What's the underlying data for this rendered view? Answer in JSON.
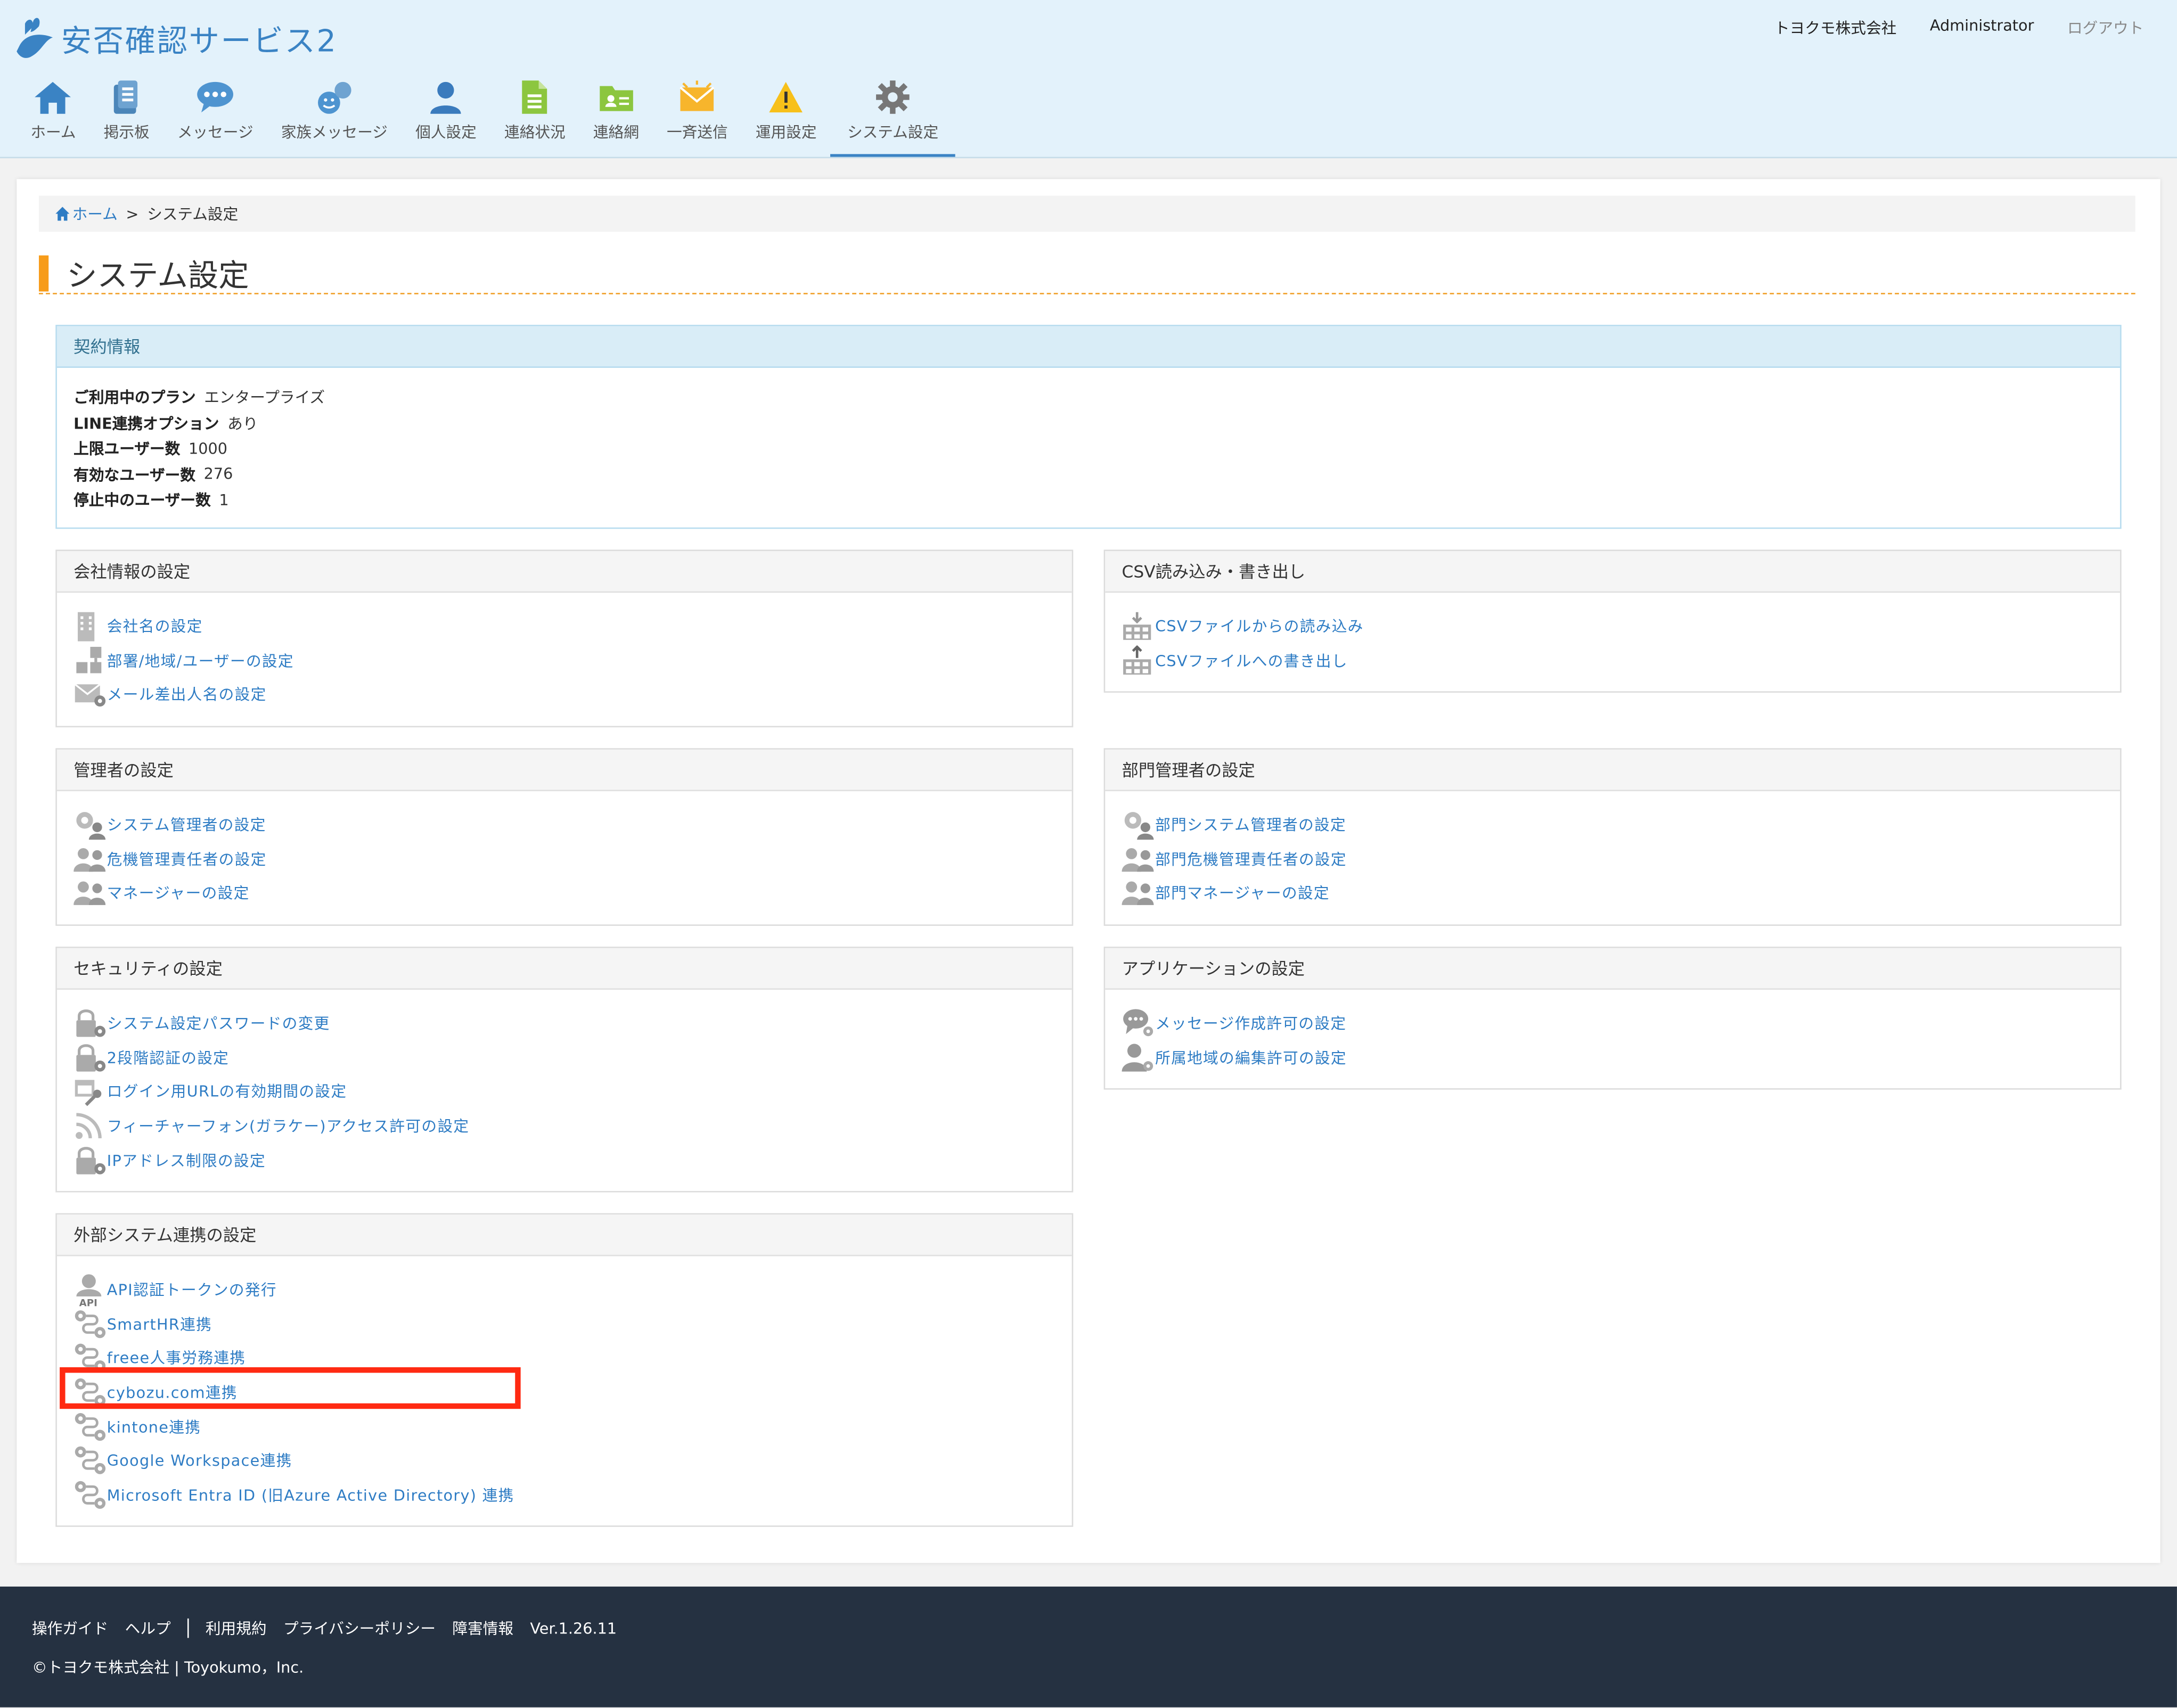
{
  "app": {
    "name": "安否確認サービス2",
    "company": "トヨクモ株式会社",
    "user": "Administrator",
    "logout": "ログアウト"
  },
  "nav": [
    {
      "label": "ホーム",
      "icon": "home-icon"
    },
    {
      "label": "掲示板",
      "icon": "board-icon"
    },
    {
      "label": "メッセージ",
      "icon": "message-icon"
    },
    {
      "label": "家族メッセージ",
      "icon": "family-message-icon"
    },
    {
      "label": "個人設定",
      "icon": "person-icon"
    },
    {
      "label": "連絡状況",
      "icon": "document-icon"
    },
    {
      "label": "連絡網",
      "icon": "contact-network-icon"
    },
    {
      "label": "一斉送信",
      "icon": "broadcast-mail-icon"
    },
    {
      "label": "運用設定",
      "icon": "warning-icon"
    },
    {
      "label": "システム設定",
      "icon": "gear-icon"
    }
  ],
  "breadcrumb": {
    "home": "ホーム",
    "sep": ">",
    "current": "システム設定"
  },
  "page_title": "システム設定",
  "contract": {
    "title": "契約情報",
    "rows": [
      {
        "label": "ご利用中のプラン",
        "value": "エンタープライズ"
      },
      {
        "label": "LINE連携オプション",
        "value": "あり"
      },
      {
        "label": "上限ユーザー数",
        "value": "1000"
      },
      {
        "label": "有効なユーザー数",
        "value": "276"
      },
      {
        "label": "停止中のユーザー数",
        "value": "1"
      }
    ]
  },
  "sections": {
    "company": {
      "title": "会社情報の設定",
      "items": [
        {
          "label": "会社名の設定",
          "icon": "building-icon"
        },
        {
          "label": "部署/地域/ユーザーの設定",
          "icon": "org-icon"
        },
        {
          "label": "メール差出人名の設定",
          "icon": "mail-gear-icon"
        }
      ]
    },
    "csv": {
      "title": "CSV読み込み・書き出し",
      "items": [
        {
          "label": "CSVファイルからの読み込み",
          "icon": "csv-import-icon"
        },
        {
          "label": "CSVファイルへの書き出し",
          "icon": "csv-export-icon"
        }
      ]
    },
    "admin": {
      "title": "管理者の設定",
      "items": [
        {
          "label": "システム管理者の設定",
          "icon": "gear-user-icon"
        },
        {
          "label": "危機管理責任者の設定",
          "icon": "users-icon"
        },
        {
          "label": "マネージャーの設定",
          "icon": "users-icon"
        }
      ]
    },
    "dept_admin": {
      "title": "部門管理者の設定",
      "items": [
        {
          "label": "部門システム管理者の設定",
          "icon": "gear-user-icon"
        },
        {
          "label": "部門危機管理責任者の設定",
          "icon": "users-icon"
        },
        {
          "label": "部門マネージャーの設定",
          "icon": "users-icon"
        }
      ]
    },
    "security": {
      "title": "セキュリティの設定",
      "items": [
        {
          "label": "システム設定パスワードの変更",
          "icon": "lock-gear-icon"
        },
        {
          "label": "2段階認証の設定",
          "icon": "lock-gear-icon"
        },
        {
          "label": "ログイン用URLの有効期間の設定",
          "icon": "calendar-key-icon"
        },
        {
          "label": "フィーチャーフォン(ガラケー)アクセス許可の設定",
          "icon": "wireless-icon"
        },
        {
          "label": "IPアドレス制限の設定",
          "icon": "lock-gear-icon"
        }
      ]
    },
    "application": {
      "title": "アプリケーションの設定",
      "items": [
        {
          "label": "メッセージ作成許可の設定",
          "icon": "speech-gear-icon"
        },
        {
          "label": "所属地域の編集許可の設定",
          "icon": "user-gear-icon"
        }
      ]
    },
    "external": {
      "title": "外部システム連携の設定",
      "items": [
        {
          "label": "API認証トークンの発行",
          "icon": "api-user-icon"
        },
        {
          "label": "SmartHR連携",
          "icon": "link-icon"
        },
        {
          "label": "freee人事労務連携",
          "icon": "link-icon"
        },
        {
          "label": "cybozu.com連携",
          "icon": "link-icon"
        },
        {
          "label": "kintone連携",
          "icon": "link-icon"
        },
        {
          "label": "Google Workspace連携",
          "icon": "link-icon"
        },
        {
          "label": "Microsoft Entra ID (旧Azure Active Directory) 連携",
          "icon": "link-icon"
        }
      ]
    }
  },
  "footer": {
    "links": [
      "操作ガイド",
      "ヘルプ",
      "利用規約",
      "プライバシーポリシー",
      "障害情報",
      "Ver.1.26.11"
    ],
    "copyright": "©トヨクモ株式会社 | Toyokumo，Inc."
  },
  "colors": {
    "accent": "#3a83c4",
    "link": "#2e7cc4",
    "title_bar": "#f79c1a",
    "highlight": "#ff2a12",
    "footer_bg": "#253141"
  }
}
